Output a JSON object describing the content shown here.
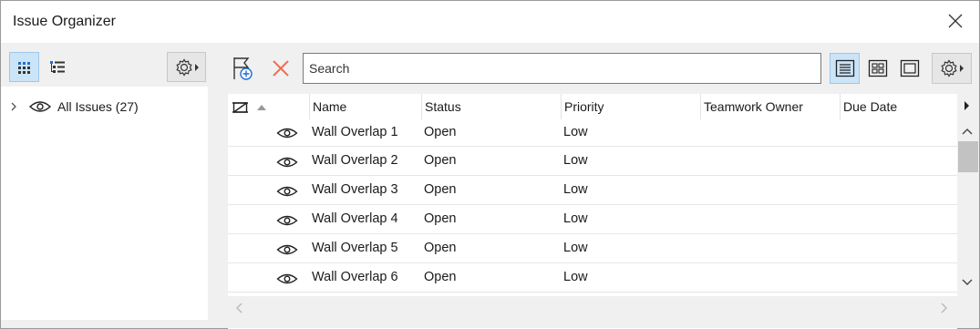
{
  "window": {
    "title": "Issue Organizer"
  },
  "left_panel": {
    "tree": [
      {
        "label": "All Issues (27)"
      }
    ]
  },
  "toolbar": {
    "search_placeholder": "Search"
  },
  "grid": {
    "columns": [
      "Name",
      "Status",
      "Priority",
      "Teamwork Owner",
      "Due Date"
    ],
    "rows": [
      {
        "name": "Wall Overlap 1",
        "status": "Open",
        "priority": "Low",
        "owner": "",
        "due": ""
      },
      {
        "name": "Wall Overlap 2",
        "status": "Open",
        "priority": "Low",
        "owner": "",
        "due": ""
      },
      {
        "name": "Wall Overlap 3",
        "status": "Open",
        "priority": "Low",
        "owner": "",
        "due": ""
      },
      {
        "name": "Wall Overlap 4",
        "status": "Open",
        "priority": "Low",
        "owner": "",
        "due": ""
      },
      {
        "name": "Wall Overlap 5",
        "status": "Open",
        "priority": "Low",
        "owner": "",
        "due": ""
      },
      {
        "name": "Wall Overlap 6",
        "status": "Open",
        "priority": "Low",
        "owner": "",
        "due": ""
      }
    ]
  },
  "colors": {
    "accent": "#1e6fcf",
    "selected_bg": "#cce4f7",
    "delete": "#f26d4f"
  }
}
